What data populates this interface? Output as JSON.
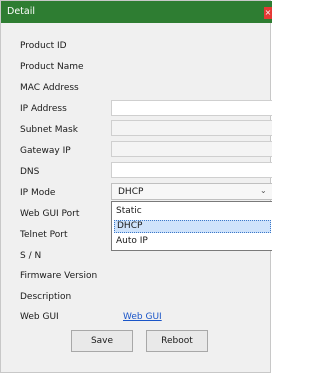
{
  "title": "Detail",
  "close_glyph": "×",
  "labels": {
    "product_id": "Product ID",
    "product_name": "Product Name",
    "mac_address": "MAC Address",
    "ip_address": "IP Address",
    "subnet_mask": "Subnet Mask",
    "gateway_ip": "Gateway IP",
    "dns": "DNS",
    "ip_mode": "IP Mode",
    "web_gui_port": "Web GUI Port",
    "telnet_port": "Telnet Port",
    "sn": "S / N",
    "firmware_version": "Firmware Version",
    "description": "Description",
    "web_gui": "Web GUI"
  },
  "ip_mode": {
    "selected": "DHCP",
    "options": [
      "Static",
      "DHCP",
      "Auto IP"
    ],
    "highlighted": "DHCP"
  },
  "web_gui_link": "Web GUI",
  "buttons": {
    "save": "Save",
    "reboot": "Reboot"
  },
  "colors": {
    "titlebar": "#2e7d32",
    "close": "#e53935",
    "link": "#1a55c8",
    "highlight": "#cfe3fb"
  },
  "icons": {
    "close": "close-icon",
    "dropdown": "chevron-down-icon"
  }
}
